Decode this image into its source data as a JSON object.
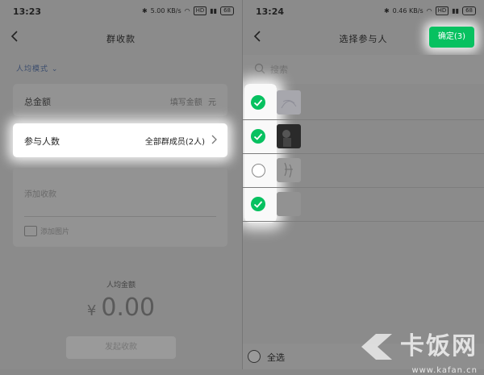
{
  "left": {
    "status": {
      "time": "13:23",
      "speed": "5.00 KB/s",
      "battery": "68"
    },
    "nav": {
      "title": "群收款"
    },
    "mode": "人均模式",
    "total": {
      "label": "总金额",
      "placeholder": "填写金额",
      "unit": "元"
    },
    "participants": {
      "label": "参与人数",
      "value": "全部群成员(2人)"
    },
    "note": {
      "placeholder": "添加收款",
      "image_label": "添加图片"
    },
    "per_person": {
      "label": "人均金额",
      "currency": "¥",
      "amount": "0.00"
    },
    "initiate_button": "发起收款"
  },
  "right": {
    "status": {
      "time": "13:24",
      "speed": "0.46 KB/s",
      "battery": "68"
    },
    "nav": {
      "title": "选择参与人",
      "confirm": "确定(3)"
    },
    "search_placeholder": "搜索",
    "members": [
      {
        "checked": true,
        "name": ""
      },
      {
        "checked": true,
        "name": ""
      },
      {
        "checked": false,
        "name": ""
      },
      {
        "checked": true,
        "name": ""
      }
    ],
    "select_all": "全选"
  },
  "watermark": {
    "brand": "卡饭网",
    "url": "www.kafan.cn"
  },
  "colors": {
    "accent": "#07c160",
    "link": "#3b4d6e"
  }
}
